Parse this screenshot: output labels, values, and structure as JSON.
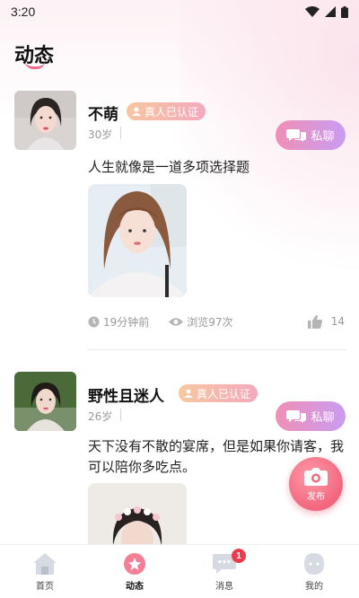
{
  "status_bar": {
    "time": "3:20"
  },
  "page": {
    "title": "动态"
  },
  "posts": [
    {
      "name": "不萌",
      "badge": "真人已认证",
      "age": "30岁",
      "chat_label": "私聊",
      "text": "人生就像是一道多项选择题",
      "time_ago": "19分钟前",
      "views": "浏览97次",
      "likes": "14"
    },
    {
      "name": "野性且迷人",
      "badge": "真人已认证",
      "age": "26岁",
      "chat_label": "私聊",
      "text": "天下没有不散的宴席，但是如果你请客，我可以陪你多吃点。"
    }
  ],
  "fab": {
    "label": "发布"
  },
  "tabbar": {
    "items": [
      {
        "label": "首页",
        "icon": "home-icon"
      },
      {
        "label": "动态",
        "icon": "moments-icon"
      },
      {
        "label": "消息",
        "icon": "chat-bubble-icon"
      },
      {
        "label": "我的",
        "icon": "profile-icon"
      }
    ],
    "active_index": 1,
    "message_badge": "1"
  },
  "colors": {
    "accent_pink": "#f06a8c",
    "chat_gradient_start": "#f08fb5",
    "chat_gradient_end": "#c99cf2",
    "badge_gradient_start": "#f7c7a0",
    "badge_gradient_end": "#f4a9bd",
    "badge_red": "#f03a4b"
  }
}
